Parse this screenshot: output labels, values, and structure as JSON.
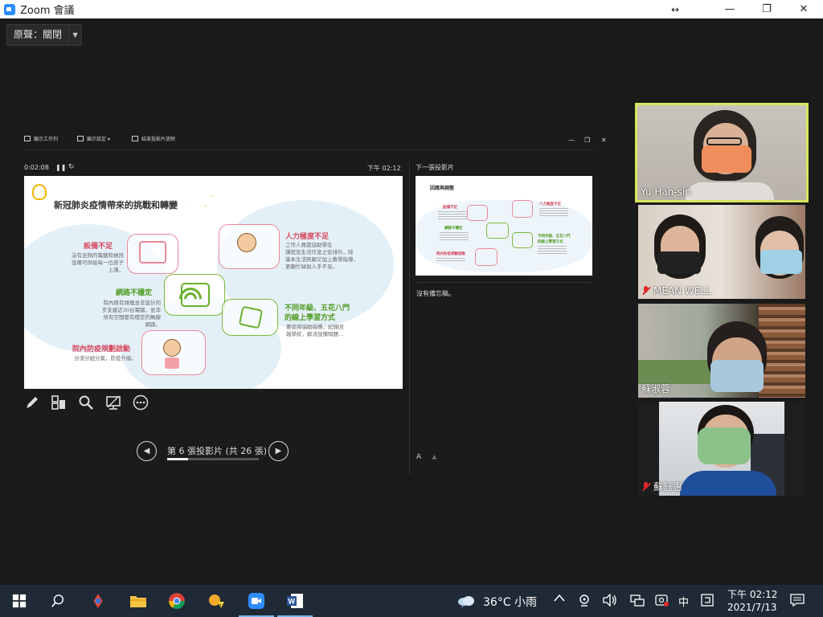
{
  "window": {
    "title": "Zoom 會議",
    "minimize": "—",
    "maximize": "❐",
    "close": "✕",
    "resize_cursor": "↔"
  },
  "original_sound": {
    "label": "原聲：關閉",
    "arrow": "▼"
  },
  "presenter": {
    "toolbar": {
      "show_taskbar": "顯示工作列",
      "display_settings": "顯示設定 ▾",
      "end_slideshow": "結束投影片放映"
    },
    "timer": "0:02:08",
    "pause": "❚❚",
    "restart": "↻",
    "clock": "下午 02:12",
    "next_slide_label": "下一張投影片",
    "notes": "沒有備忘稿。",
    "font_up": "A",
    "font_down": "A",
    "slide_indicator": "第 6 張投影片 (共 26 張)",
    "progress": 0.2308,
    "prev": "◀",
    "next": "▶"
  },
  "slide": {
    "title": "新冠肺炎疫情帶來的挑戰和轉變",
    "items": [
      {
        "heading": "設備不足",
        "body": [
          "沒有足夠的電腦和視訊",
          "設備可供給每一位孩子",
          "上課。"
        ]
      },
      {
        "heading": "人力極度不足",
        "body": [
          "工作人員需協助學生",
          "課程及生活作息之安排外，除",
          "基本生活照顧又加上教學指導，",
          "更顯忙碌與人手不足。"
        ]
      },
      {
        "heading": "網路不穩定",
        "body": [
          "院內原有頻寬並非設計同",
          "步支援近30台電腦，並非",
          "所有空間都有穩定的無線",
          "網路。"
        ]
      },
      {
        "heading": "不同年級、五花八門",
        "heading2": "的線上學習方式",
        "body": [
          "要從旁協助指導，紀錄回",
          "報學校，解決設備問題..."
        ]
      },
      {
        "heading": "院內防疫規劃啟動",
        "body": [
          "分流分組分案，防疫升級。"
        ]
      }
    ]
  },
  "next_slide": {
    "title": "因應與調整",
    "headings": [
      "設備不足",
      "人力極度不足",
      "網路不穩定",
      "不同年級、五花八門",
      "的線上學習方式",
      "院內防疫規劃啟動"
    ]
  },
  "participants": [
    {
      "name": "Yu Han-sin",
      "muted": false,
      "active": true
    },
    {
      "name": "MEAN WELL",
      "muted": true,
      "active": false
    },
    {
      "name": "蘇淑蓉",
      "muted": false,
      "active": false
    },
    {
      "name": "蘇鈺惠",
      "muted": true,
      "active": false
    }
  ],
  "taskbar": {
    "weather": "36°C 小雨",
    "ime": "中",
    "time": "下午 02:12",
    "date": "2021/7/13"
  },
  "colors": {
    "pink": "#d6475e",
    "green": "#4f9a1e",
    "active_speaker": "#d8e65a",
    "taskbar": "#1f2a36"
  }
}
